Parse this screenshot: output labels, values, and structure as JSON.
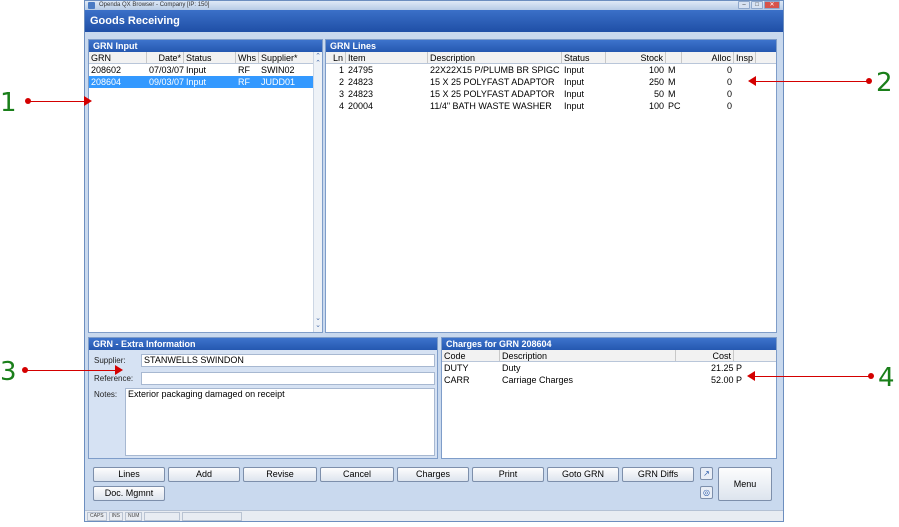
{
  "window": {
    "title": "Openda QX Browser - Company [IP: 150]",
    "app_title": "Goods Receiving"
  },
  "grn_input": {
    "title": "GRN Input",
    "columns": [
      "GRN",
      "Date*",
      "Status",
      "Whs",
      "Supplier*"
    ],
    "rows": [
      {
        "grn": "208602",
        "date": "07/03/07",
        "status": "Input",
        "whs": "RF",
        "supplier": "SWIN02",
        "selected": false
      },
      {
        "grn": "208604",
        "date": "09/03/07",
        "status": "Input",
        "whs": "RF",
        "supplier": "JUDD01",
        "selected": true
      }
    ]
  },
  "grn_lines": {
    "title": "GRN Lines",
    "columns": [
      "Ln",
      "Item",
      "Description",
      "Status",
      "Stock",
      "",
      "Alloc",
      "Insp"
    ],
    "rows": [
      {
        "ln": "1",
        "item": "24795",
        "description": "22X22X15 P/PLUMB BR SPIGC",
        "status": "Input",
        "stock": "100",
        "unit": "M",
        "alloc": "0",
        "insp": ""
      },
      {
        "ln": "2",
        "item": "24823",
        "description": "15 X 25 POLYFAST ADAPTOR",
        "status": "Input",
        "stock": "250",
        "unit": "M",
        "alloc": "0",
        "insp": ""
      },
      {
        "ln": "3",
        "item": "24823",
        "description": "15 X 25 POLYFAST ADAPTOR",
        "status": "Input",
        "stock": "50",
        "unit": "M",
        "alloc": "0",
        "insp": ""
      },
      {
        "ln": "4",
        "item": "20004",
        "description": "11/4\" BATH WASTE WASHER",
        "status": "Input",
        "stock": "100",
        "unit": "PC",
        "alloc": "0",
        "insp": ""
      }
    ]
  },
  "extra_info": {
    "title": "GRN - Extra Information",
    "supplier_label": "Supplier:",
    "supplier_value": "STANWELLS SWINDON",
    "reference_label": "Reference:",
    "reference_value": "",
    "notes_label": "Notes:",
    "notes_value": "Exterior packaging damaged on receipt"
  },
  "charges": {
    "title": "Charges for GRN 208604",
    "columns": [
      "Code",
      "Description",
      "Cost"
    ],
    "rows": [
      {
        "code": "DUTY",
        "description": "Duty",
        "cost": "21.25 P"
      },
      {
        "code": "CARR",
        "description": "Carriage Charges",
        "cost": "52.00 P"
      }
    ]
  },
  "buttons": {
    "lines": "Lines",
    "add": "Add",
    "revise": "Revise",
    "cancel": "Cancel",
    "charges": "Charges",
    "print": "Print",
    "goto_grn": "Goto GRN",
    "grn_diffs": "GRN Diffs",
    "doc_mgmnt": "Doc. Mgmnt",
    "menu": "Menu"
  },
  "statusbar": [
    "CAPS",
    "INS",
    "NUM",
    "",
    ""
  ],
  "annotations": [
    "1",
    "2",
    "3",
    "4"
  ],
  "colors": {
    "header": "#2558b0",
    "selection": "#3399ff",
    "marker_text": "#1a7f1a",
    "marker_arrow": "#d40000"
  }
}
